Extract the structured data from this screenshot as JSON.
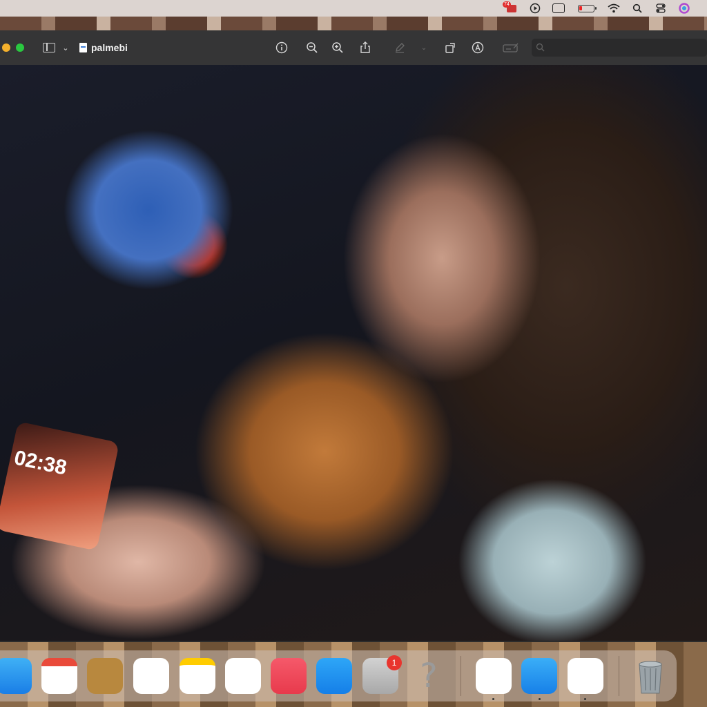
{
  "menubar": {
    "app_badge": "74",
    "icons": [
      "app-badge-icon",
      "play-circle-icon",
      "screen-mirroring-icon",
      "battery-icon",
      "wifi-icon",
      "spotlight-search-icon",
      "control-center-icon",
      "siri-icon"
    ],
    "battery_level_fraction": 0.2
  },
  "window": {
    "title": "palmebi",
    "colors": {
      "toolbar": "#353536",
      "close": "#f5b12c",
      "minimize": "#2ac840"
    }
  },
  "photo": {
    "phone_clock": "02:38"
  },
  "dock": {
    "notification_badge": "1",
    "apps": [
      "finder-app",
      "calendar-app",
      "notes-app-brown",
      "app-white-1",
      "notes-app",
      "app-white-2",
      "music-app",
      "app-store-blue",
      "system-settings-app",
      "unknown-app",
      "app-white-3",
      "app-blue-2",
      "app-white-4",
      "trash"
    ]
  }
}
